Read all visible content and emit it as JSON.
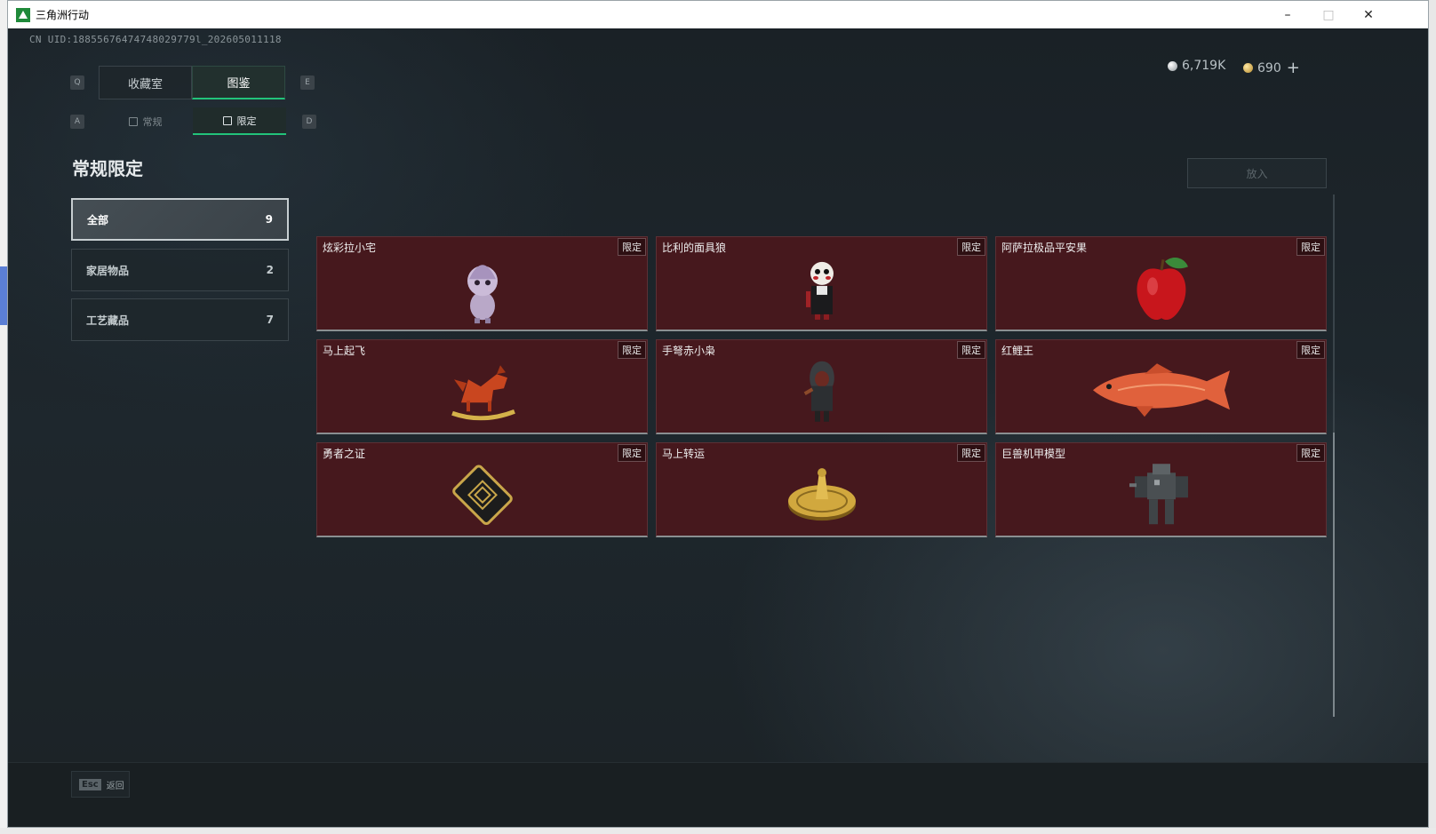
{
  "window": {
    "title": "三角洲行动",
    "minimize": "–",
    "maximize": "□",
    "close": "✕"
  },
  "uid": "CN UID:18855676474748029779l_202605011118",
  "currency": [
    {
      "value": "6,719K",
      "type": "silver"
    },
    {
      "value": "690",
      "type": "gold",
      "plus": "+"
    }
  ],
  "top_tabs": {
    "left_key": "Q",
    "right_key": "E",
    "items": [
      {
        "label": "收藏室",
        "active": false
      },
      {
        "label": "图鉴",
        "active": true
      }
    ]
  },
  "sub_tabs": {
    "left_key": "A",
    "right_key": "D",
    "items": [
      {
        "label": "常规",
        "active": false
      },
      {
        "label": "限定",
        "active": true
      }
    ]
  },
  "page_title": "常规限定",
  "categories": [
    {
      "label": "全部",
      "count": "9",
      "active": true
    },
    {
      "label": "家居物品",
      "count": "2",
      "active": false
    },
    {
      "label": "工艺藏品",
      "count": "7",
      "active": false
    }
  ],
  "place_button": "放入",
  "items": [
    {
      "name": "炫彩拉小宅",
      "badge": "限定",
      "icon": "doll-icon"
    },
    {
      "name": "比利的面具狼",
      "badge": "限定",
      "icon": "puppet-icon"
    },
    {
      "name": "阿萨拉极品平安果",
      "badge": "限定",
      "icon": "apple-icon"
    },
    {
      "name": "马上起飞",
      "badge": "限定",
      "icon": "rocking-horse-icon"
    },
    {
      "name": "手弩赤小枭",
      "badge": "限定",
      "icon": "hooded-figure-icon"
    },
    {
      "name": "红鲤王",
      "badge": "限定",
      "icon": "carp-icon"
    },
    {
      "name": "勇者之证",
      "badge": "限定",
      "icon": "card-icon"
    },
    {
      "name": "马上转运",
      "badge": "限定",
      "icon": "golden-coin-icon"
    },
    {
      "name": "巨兽机甲模型",
      "badge": "限定",
      "icon": "mech-icon"
    }
  ],
  "footer": {
    "esc_key": "Esc",
    "esc_label": "返回"
  },
  "colors": {
    "accent": "#22c37a",
    "card_bg": "#46181d",
    "bg": "#1c2328"
  }
}
